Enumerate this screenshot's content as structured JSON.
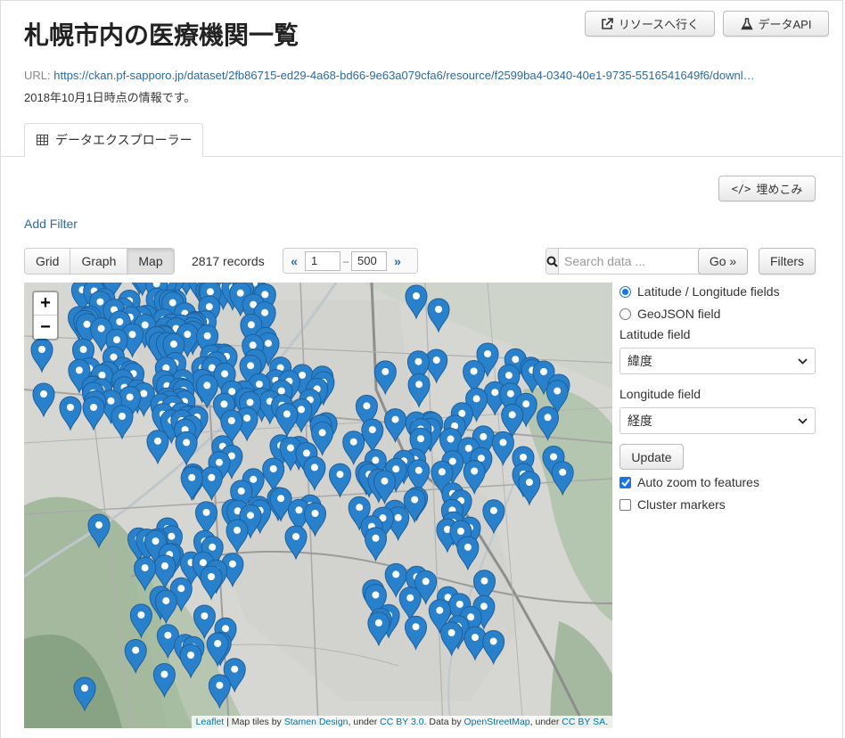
{
  "page": {
    "title": "札幌市内の医療機関一覧",
    "url_label": "URL:",
    "url": "https://ckan.pf-sapporo.jp/dataset/2fb86715-ed29-4a68-bd66-9e63a079cfa6/resource/f2599ba4-0340-40e1-9735-5516541649f6/downl…",
    "date_info": "2018年10月1日時点の情報です。"
  },
  "header_buttons": {
    "resource": "リソースへ行く",
    "api": "データAPI"
  },
  "tabs": [
    {
      "label": "データエクスプローラー",
      "icon": "table-icon"
    }
  ],
  "embed_button": "埋めこみ",
  "add_filter": "Add Filter",
  "view_modes": {
    "items": [
      "Grid",
      "Graph",
      "Map"
    ],
    "active": "Map"
  },
  "records": "2817 records",
  "pager": {
    "prev": "«",
    "next": "»",
    "from": "1",
    "to": "500",
    "dash": "–"
  },
  "search": {
    "placeholder": "Search data ...",
    "go": "Go »",
    "filters": "Filters"
  },
  "map": {
    "zoom_in": "+",
    "zoom_out": "−",
    "marker_color": "#2a81cb",
    "attribution": {
      "leaflet": "Leaflet",
      "sep": " | Map tiles by ",
      "stamen": "Stamen Design",
      "under1": ", under ",
      "ccby": "CC BY 3.0",
      "data_by": ". Data by ",
      "osm": "OpenStreetMap",
      "under2": ", under ",
      "ccbysa": "CC BY SA",
      "end": "."
    }
  },
  "sidebar": {
    "radio_latlon": "Latitude / Longitude fields",
    "radio_geojson": "GeoJSON field",
    "lat_label": "Latitude field",
    "lat_value": "緯度",
    "lon_label": "Longitude field",
    "lon_value": "経度",
    "update": "Update",
    "auto_zoom": "Auto zoom to features",
    "cluster": "Cluster markers"
  }
}
